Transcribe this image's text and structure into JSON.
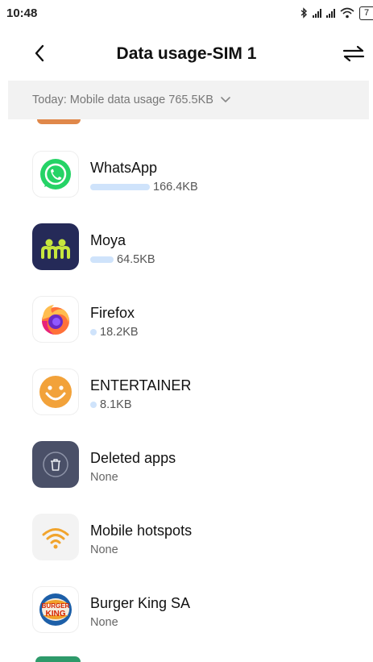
{
  "status_bar": {
    "time": "10:48",
    "battery_level": "7"
  },
  "header": {
    "title": "Data usage-SIM 1"
  },
  "filter": {
    "label": "Today: Mobile data usage 765.5KB"
  },
  "apps": [
    {
      "name": "WhatsApp",
      "usage": "166.4KB",
      "bar_fraction": 0.217
    },
    {
      "name": "Moya",
      "usage": "64.5KB",
      "bar_fraction": 0.084
    },
    {
      "name": "Firefox",
      "usage": "18.2KB",
      "bar_fraction": 0.024
    },
    {
      "name": "ENTERTAINER",
      "usage": "8.1KB",
      "bar_fraction": 0.011
    },
    {
      "name": "Deleted apps",
      "usage": "None"
    },
    {
      "name": "Mobile hotspots",
      "usage": "None"
    },
    {
      "name": "Burger King SA",
      "usage": "None"
    }
  ],
  "logos": {
    "burger_king_line1": "BURGER",
    "burger_king_line2": "KING"
  },
  "colors": {
    "usage_bar": "#cfe3fb",
    "whatsapp": "#25d366",
    "moya_bg": "#252a58",
    "moya_accent": "#c6e63d",
    "entertainer": "#f2a23a",
    "deleted_bg": "#4a5068",
    "hotspot": "#f1a42d"
  }
}
